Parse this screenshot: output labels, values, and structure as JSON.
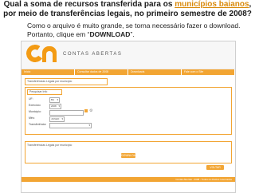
{
  "question": {
    "before": "Qual a soma de recursos transferida para os ",
    "highlight": "municípios baianos",
    "after": ", por meio de transferências legais, no primeiro semestre de 2008?"
  },
  "note": {
    "before": "Como o arquivo é muito grande, se torna necessário fazer o download. Portanto, clique em “",
    "bold": "DOWNLOAD",
    "after": "”."
  },
  "colors": {
    "accent": "#f39b14",
    "highlight": "#d98a0c"
  },
  "site": {
    "brand": "CONTAS ABERTAS"
  },
  "nav": {
    "items": [
      "Início",
      "Consultar dados de 2008",
      "Downloads",
      "Fale com o Site"
    ]
  },
  "crumb": "Transferências Legais por município",
  "form": {
    "title": "Pesquisar Info",
    "fields": [
      {
        "label": "UF:",
        "value": "BA"
      },
      {
        "label": "Exercício:",
        "value": "2008"
      },
      {
        "label": "Município:",
        "value": ""
      },
      {
        "label": "Mês:",
        "value": "JUNHO"
      },
      {
        "label": "Transferência:",
        "value": ""
      }
    ]
  },
  "results": {
    "title": "Transferências Legais por município",
    "download_label": "DOWNLOAD",
    "back_label": "VOLTAR"
  },
  "footer": {
    "text": "Contas Abertas - 2008 - Todos os direitos reservados"
  },
  "icons": {
    "edit": "pencil-icon",
    "settings": "gear-icon"
  }
}
